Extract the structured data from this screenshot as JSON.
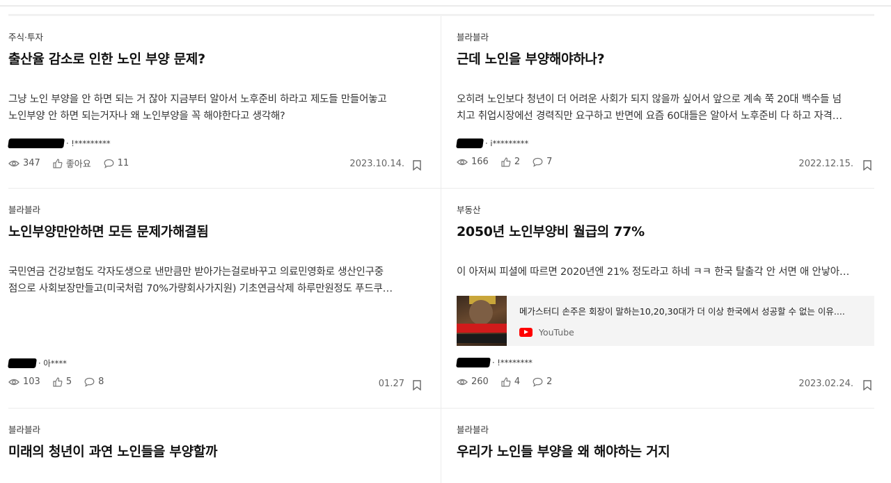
{
  "posts": [
    {
      "category": "주식·투자",
      "title": "출산율 감소로 인한 노인 부양 문제?",
      "body": [
        "그냥 노인 부양을 안 하면 되는 거 잖아 지금부터 알아서 노후준비 하라고 제도들 만들어놓고",
        "노인부양 안 하면 되는거자나 왜 노인부양을 꼭 해야한다고 생각해?"
      ],
      "author": "· !*********",
      "views": "347",
      "likes": "좋아요",
      "comments": "11",
      "date": "2023.10.14."
    },
    {
      "category": "블라블라",
      "title": "근데 노인을 부양해야하나?",
      "body": [
        "오히려 노인보다 청년이 더 어려운 사회가 되지 않을까 싶어서 앞으로 계속 쭉 20대 백수들 넘",
        "치고 취업시장에선 경력직만 요구하고 반면에 요즘 60대들은 알아서 노후준비 다 하고 자격…"
      ],
      "author": "· i*********",
      "views": "166",
      "likes": "2",
      "comments": "7",
      "date": "2022.12.15."
    },
    {
      "category": "블라블라",
      "title": "노인부양만안하면 모든 문제가해결됨",
      "body": [
        "국민연금 건강보험도 각자도생으로 낸만큼만 받아가는걸로바꾸고 의료민영화로 생산인구중",
        "점으로 사회보장만들고(미국처럼 70%가량회사가지원) 기초연금삭제 하루만원정도 푸드쿠…"
      ],
      "author": "· 아****",
      "views": "103",
      "likes": "5",
      "comments": "8",
      "date": "01.27"
    },
    {
      "category": "부동산",
      "title": "2050년 노인부양비 월급의 77%",
      "body": [
        "이 아저씨 피셜에 따르면 2020년엔 21% 정도라고 하네 ㅋㅋ 한국 탈출각 안 서면 애 안낳아…"
      ],
      "author": "· !********",
      "views": "260",
      "likes": "4",
      "comments": "2",
      "date": "2023.02.24.",
      "embed": {
        "title": "메가스터디 손주은 회장이 말하는10,20,30대가 더 이상 한국에서 성공할 수 없는 이유....",
        "source": "YouTube"
      }
    },
    {
      "category": "블라블라",
      "title": "미래의 청년이 과연 노인들을 부양할까"
    },
    {
      "category": "블라블라",
      "title": "우리가 노인들 부양을 왜 해야하는 거지"
    }
  ],
  "icons": {
    "views": "eye-icon",
    "likes": "thumbs-up-icon",
    "comments": "comment-icon",
    "save": "bookmark-icon"
  }
}
